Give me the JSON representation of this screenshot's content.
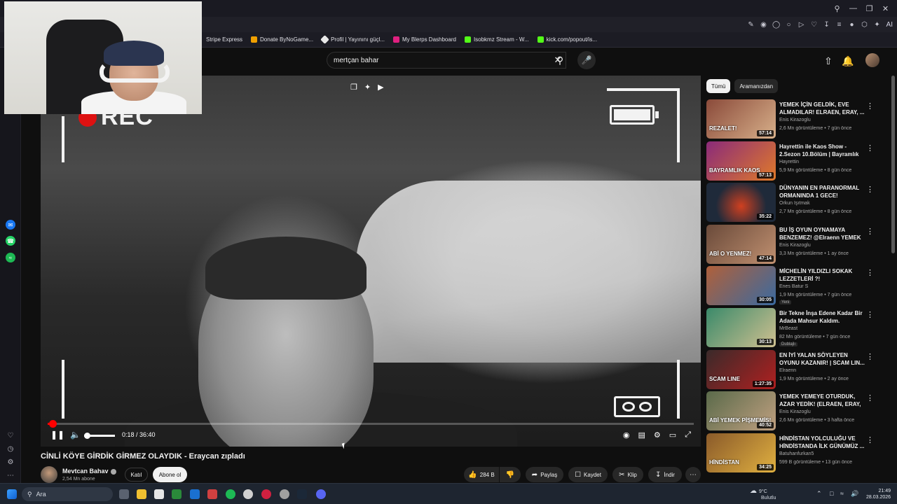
{
  "browser": {
    "bookmarks": [
      {
        "label": "Stripe Express",
        "color": "#635bff"
      },
      {
        "label": "Donate ByNoGame...",
        "color": "#f0a000"
      },
      {
        "label": "Profil | Yayınını güçl...",
        "color": "#e8e8e8"
      },
      {
        "label": "My Blerps Dashboard",
        "color": "#e02080"
      },
      {
        "label": "Isobkmz Stream - W...",
        "color": "#53fc18"
      },
      {
        "label": "kick.com/popout/is...",
        "color": "#53fc18"
      }
    ],
    "ai_label": "AI"
  },
  "youtube": {
    "search": {
      "value": "mertçan bahar"
    },
    "video": {
      "title": "CİNLİ KÖYE GİRDİK GİRMEZ OLAYDIK - Eraycan zıpladı",
      "time": "0:18 / 36:40",
      "overlay_text": "REC",
      "progress": 0.008
    },
    "channel": {
      "name": "Mevtcan Bahav",
      "subs": "2,54 Mn abone",
      "join_label": "Katıl",
      "subscribe_label": "Abone ol"
    },
    "actions": {
      "like": "284 B",
      "share": "Paylaş",
      "save": "Kaydet",
      "clip": "Klip",
      "download": "İndir"
    },
    "chips": [
      "Tümü",
      "Aramanızdan"
    ],
    "recommendations": [
      {
        "title": "YEMEK İÇİN GELDİK, EVE ALMADILAR! ELRAEN, ERAY, ...",
        "channel": "Enis Kirazoglu",
        "meta": "2,6 Mn görüntüleme • 7 gün önce",
        "duration": "57:14",
        "thumb_text": "REZALET!",
        "thumb_color": "#8a4a3a"
      },
      {
        "title": "Hayrettin ile Kaos Show - 2.Sezon 10.Bölüm | Bayramlık ...",
        "channel": "Hayrettin",
        "meta": "5,9 Mn görüntüleme • 8 gün önce",
        "duration": "57:13",
        "thumb_text": "BAYRAMLIK KAOS",
        "thumb_color": "#8a2a7a"
      },
      {
        "title": "DÜNYANIN EN PARANORMAL ORMANINDA 1 GECE!",
        "channel": "Orkun Işıtmak",
        "meta": "2,7 Mn görüntüleme • 8 gün önce",
        "duration": "35:22",
        "thumb_text": "",
        "thumb_color": "#1f2a3a"
      },
      {
        "title": "BU İŞ OYUN OYNAMAYA BENZEMEZ! @Elraenn YEMEK ...",
        "channel": "Enis Kirazoglu",
        "meta": "3,3 Mn görüntüleme • 1 ay önce",
        "duration": "47:14",
        "thumb_text": "ABİ O YENMEZ!",
        "thumb_color": "#6a4a3a"
      },
      {
        "title": "MİCHELİN YILDIZLI SOKAK LEZZETLERİ ?!",
        "channel": "Enes Batur S",
        "meta": "1,9 Mn görüntüleme • 7 gün önce",
        "duration": "30:05",
        "badge": "Yeni",
        "thumb_text": "",
        "thumb_color": "#b0603a"
      },
      {
        "title": "Bir Tekne İnşa Edene Kadar Bir Adada Mahsur Kaldım.",
        "channel": "MrBeast",
        "meta": "82 Mn görüntüleme • 7 gün önce",
        "duration": "30:13",
        "badge": "Dublajlı",
        "thumb_text": "",
        "thumb_color": "#3a8a6a"
      },
      {
        "title": "EN İYİ YALAN SÖYLEYEN OYUNU KAZANIR! | SCAM LIN...",
        "channel": "Elraenn",
        "meta": "1,9 Mn görüntüleme • 2 ay önce",
        "duration": "1:27:35",
        "thumb_text": "SCAM LINE",
        "thumb_color": "#3a2a2a"
      },
      {
        "title": "YEMEK YEMEYE OTURDUK, AZAR YEDİK! (ELRAEN, ERAY, ...",
        "channel": "Enis Kirazoglu",
        "meta": "2,6 Mn görüntüleme • 3 hafta önce",
        "duration": "40:52",
        "thumb_text": "ABİ YEMEK PİŞMEMİŞ!",
        "thumb_color": "#5a6a4a"
      },
      {
        "title": "HİNDİSTAN YOLCULUĞU VE HİNDİSTANDA İLK GÜNÜMÜZ ...",
        "channel": "Batuhanfurkan5",
        "meta": "599 B görüntüleme • 13 gün önce",
        "duration": "34:25",
        "thumb_text": "HİNDİSTAN",
        "thumb_color": "#8a5a2a"
      }
    ]
  },
  "taskbar": {
    "search": "Ara",
    "weather_temp": "9°C",
    "weather_desc": "Bulutlu",
    "time": "21:49",
    "date": "28.03.2026"
  }
}
